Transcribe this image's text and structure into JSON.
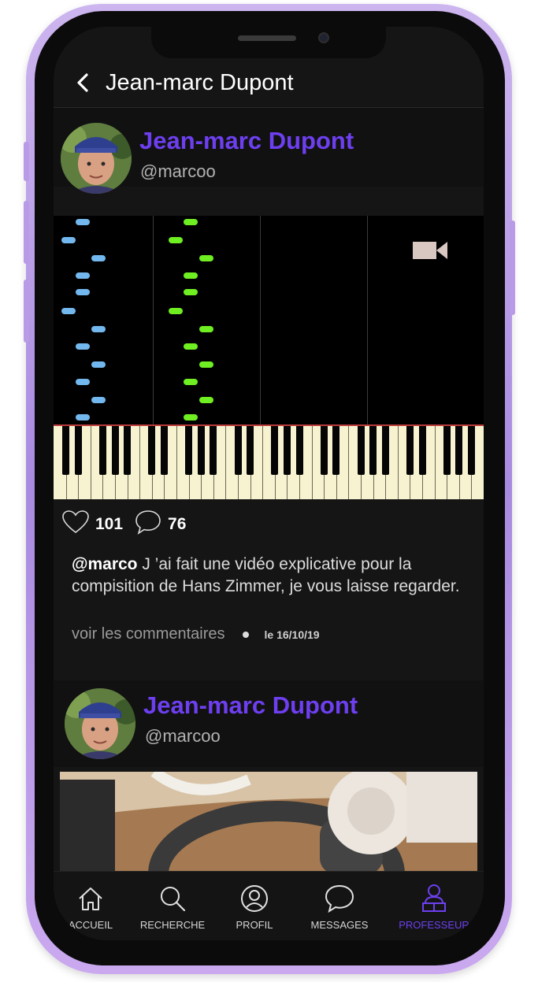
{
  "header": {
    "title": "Jean-marc Dupont",
    "back_icon": "chevron-left-icon"
  },
  "posts": [
    {
      "author": {
        "name": "Jean-marc Dupont",
        "handle": "@marcoo"
      },
      "media": {
        "type": "video",
        "icon": "video-camera-icon"
      },
      "likes": "101",
      "comments": "76",
      "caption": {
        "user": "@marco",
        "text": " J ’ai fait une vidéo explicative pour la compisition de Hans Zimmer, je vous laisse regarder."
      },
      "see_comments": "voir les commentaires",
      "date": "le 16/10/19"
    },
    {
      "author": {
        "name": "Jean-marc Dupont",
        "handle": "@marcoo"
      },
      "media": {
        "type": "photo"
      }
    }
  ],
  "tabbar": {
    "items": [
      {
        "label": "ACCUEIL",
        "icon": "home-icon"
      },
      {
        "label": "RECHERCHE",
        "icon": "search-icon"
      },
      {
        "label": "PROFIL",
        "icon": "user-icon"
      },
      {
        "label": "MESSAGES",
        "icon": "chat-bubble-icon"
      },
      {
        "label": "PROFESSEUR",
        "icon": "teacher-icon",
        "active": true
      }
    ]
  },
  "colors": {
    "accent": "#6d3ff0",
    "background": "#151515",
    "frame": "#b89ae6",
    "note_blue": "#72b8ee",
    "note_green": "#6fee22"
  }
}
